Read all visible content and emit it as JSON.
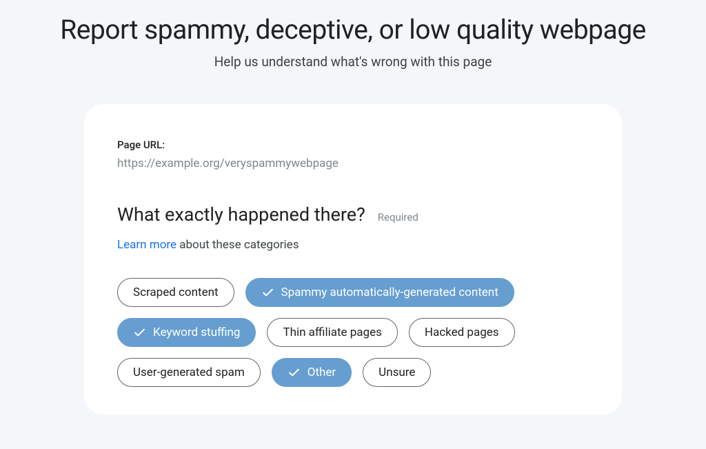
{
  "header": {
    "title": "Report spammy, deceptive, or low quality webpage",
    "subtitle": "Help us understand what's wrong with this page"
  },
  "card": {
    "url_label": "Page URL:",
    "url_value": "https://example.org/veryspammywebpage",
    "question_title": "What exactly happened there?",
    "required_label": "Required",
    "learn_more_link": "Learn more",
    "learn_more_suffix": " about these categories",
    "categories": [
      {
        "label": "Scraped content",
        "selected": false
      },
      {
        "label": "Spammy automatically-generated content",
        "selected": true
      },
      {
        "label": "Keyword stuffing",
        "selected": true
      },
      {
        "label": "Thin affiliate pages",
        "selected": false
      },
      {
        "label": "Hacked pages",
        "selected": false
      },
      {
        "label": "User-generated spam",
        "selected": false
      },
      {
        "label": "Other",
        "selected": true
      },
      {
        "label": "Unsure",
        "selected": false
      }
    ]
  }
}
